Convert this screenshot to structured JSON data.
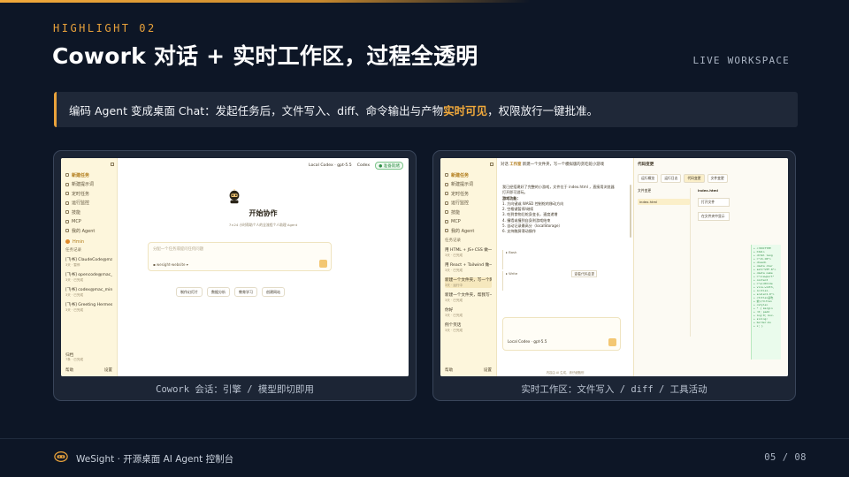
{
  "header": {
    "eyebrow": "HIGHLIGHT 02",
    "title": "Cowork 对话 + 实时工作区，过程全透明",
    "tag": "LIVE WORKSPACE"
  },
  "callout": {
    "prefix": "编码 Agent 变成桌面 Chat：发起任务后，文件写入、diff、命令输出与产物",
    "highlight": "实时可见",
    "suffix": "，权限放行一键批准。",
    "accent_color": "#e9a23b"
  },
  "left_card": {
    "caption": "Cowork 会话：引擎 / 模型即切即用",
    "app": {
      "nav": [
        "新建任务",
        "新建提示词",
        "定时任务",
        "运行监控",
        "技能",
        "MCP",
        "我的 Agent"
      ],
      "agent_badge": "Hmin",
      "section_label": "任务记录",
      "conversations": [
        {
          "title": "[飞书] ClaudeCode@mac_mini",
          "sub": "3天 · 暂停"
        },
        {
          "title": "[飞书] opencode@mac_mini",
          "sub": "3天 · 已完成"
        },
        {
          "title": "[飞书] codex@mac_mini",
          "sub": "3天 · 已完成"
        },
        {
          "title": "[飞书] Greeting Hermes A",
          "sub": "3天 · 已完成"
        }
      ],
      "bottom_section": {
        "title": "归档",
        "sub": "7条 · 已完成"
      },
      "footer_left": "帮助",
      "footer_right": "设置",
      "topbar": {
        "model": "Local Codex · gpt-5.5",
        "engine": "Codex",
        "status": "● 准备就绪"
      },
      "start_title": "开始协作",
      "start_sub": "7×24 小时帮助个人的全流程个人助理 Agent",
      "composer_placeholder": "分配一个任务或提问任何问题",
      "composer_folder": "wesight-website",
      "quick_actions": [
        "制作幻灯片",
        "数据分析",
        "教育学习",
        "创建网站"
      ]
    }
  },
  "right_card": {
    "caption": "实时工作区：文件写入 / diff / 工具活动",
    "app": {
      "nav": [
        "新建任务",
        "新建提示词",
        "定时任务",
        "运行监控",
        "技能",
        "MCP",
        "我的 Agent"
      ],
      "section_label": "任务记录",
      "conversations": [
        {
          "title": "用 HTML + JS+CSS 做一个…",
          "sub": "3天 · 已完成"
        },
        {
          "title": "用 React + Tailwind 做一个…",
          "sub": "3天 · 已完成"
        },
        {
          "title": "新建一个文件夹，写一个网…",
          "sub": "3天 · 运行中"
        },
        {
          "title": "新建一个文件夹，帮我写一个…",
          "sub": "3天 · 已完成"
        },
        {
          "title": "你好",
          "sub": "3天 · 已完成"
        },
        {
          "title": "例个笑话",
          "sub": "3天 · 已完成"
        }
      ],
      "footer_left": "帮助",
      "footer_right": "设置",
      "chat_header_tag": "对话",
      "chat_header_badge": "工作室",
      "chat_header_title": "新建一个文件夹，写一个模拟版的贪吃蛇小游戏",
      "chat_message": "我已经搭建好了完整的小游戏，文件位于 index.html ，直接用浏览器打开即可游玩。",
      "features_title": "游戏功能：",
      "features": [
        "方向键或 WASD 控制蛇的移动方向",
        "空格键暂停/继续",
        "吃到食物后蛇身变长，速度递增",
        "撞墙或撞到自身则游戏结束",
        "自动记录最高分（localStorage）",
        "支持触屏滑动操作"
      ],
      "tool_1": "Bash",
      "tool_2": "Write",
      "tool_2_action": "查看代码变更",
      "composer_model": "Local Codex · gpt-5.5",
      "composer_footer": "内容由 AI 生成，请仔细甄别",
      "ws_title": "代码变更",
      "ws_tabs": [
        "运行概览",
        "运行日志",
        "代码变更",
        "文件变更"
      ],
      "ws_files_label": "文件变更",
      "ws_file": "index.html",
      "ws_editor_file": "index.html",
      "ws_editor_btns": [
        "打开文件",
        "在文件夹中显示"
      ],
      "diff_lines": [
        "+ <!DOCTYPE",
        "+ html>",
        "+ <html lang",
        "+ =\"zh-CN\">",
        "+ <head>",
        "+ <meta char",
        "+ set=\"UTF-8\">",
        "+ <meta name",
        "+ =\"viewport\"",
        "+ content",
        "+ =\"width=de",
        "+ vice-width,",
        "+ initial-",
        "+ scale=1.0\">",
        "+ <title>贪吃",
        "+ 蛇</title>",
        "+ <style>",
        "+ * { margin",
        "+ :0; padd",
        "+ ing:0; box-",
        "+ sizing:",
        "+ border-bo",
        "+ x; }"
      ]
    }
  },
  "footer": {
    "brand": "WeSight · 开源桌面 AI Agent 控制台",
    "page": "05 / 08"
  }
}
